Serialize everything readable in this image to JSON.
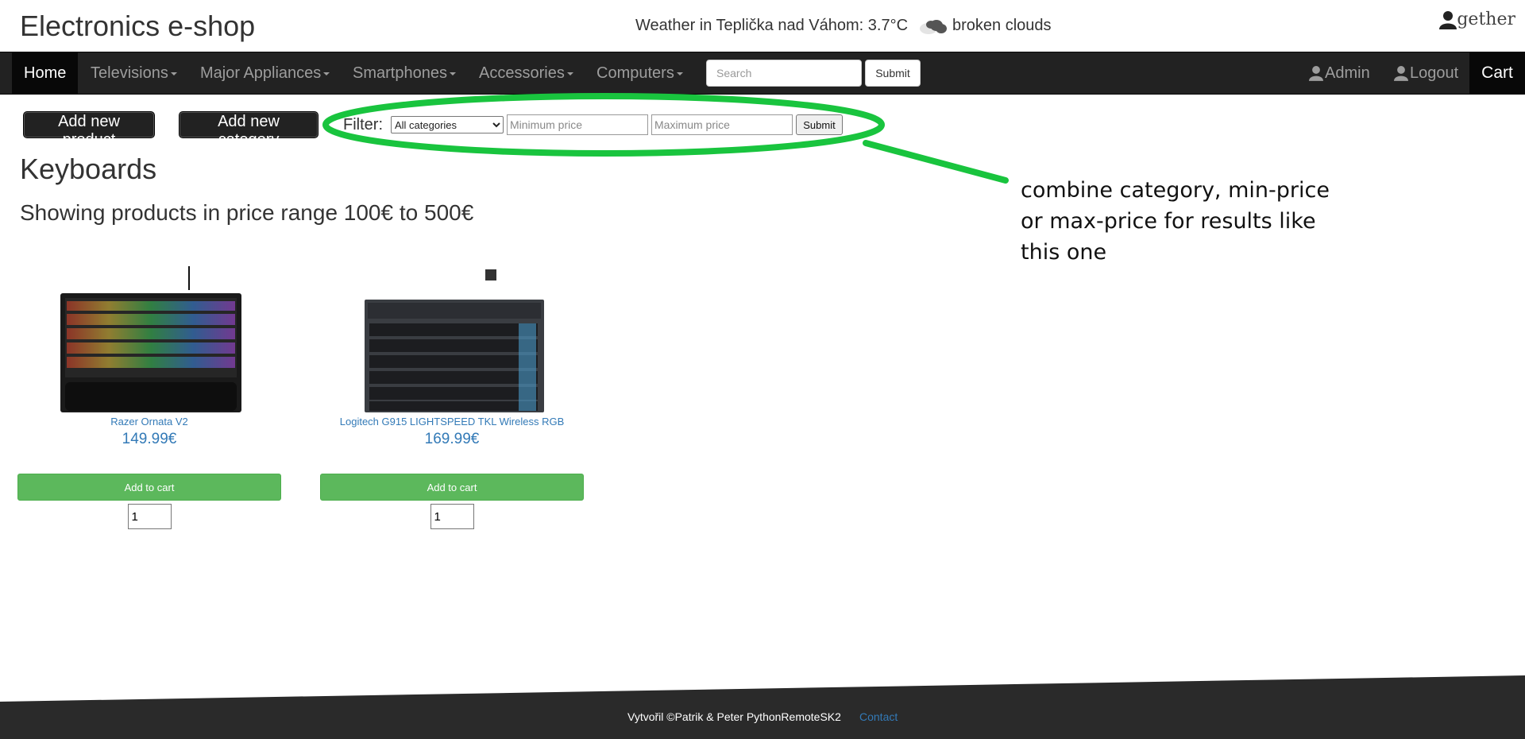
{
  "header": {
    "site_title": "Electronics e-shop",
    "weather_text": "Weather in Teplička nad Váhom: 3.7°C",
    "weather_icon": "cloud-icon",
    "weather_desc": "broken clouds",
    "username": "gether"
  },
  "nav": {
    "home": "Home",
    "items": [
      "Televisions",
      "Major Appliances",
      "Smartphones",
      "Accessories",
      "Computers"
    ],
    "search_placeholder": "Search",
    "search_submit": "Submit",
    "admin": "Admin",
    "logout": "Logout",
    "cart": "Cart"
  },
  "toolbar": {
    "add_product": "Add new product",
    "add_category": "Add new category",
    "filter_label": "Filter:",
    "category_selected": "All categories",
    "min_placeholder": "Minimum price",
    "max_placeholder": "Maximum price",
    "filter_submit": "Submit"
  },
  "annotation": {
    "text": "combine category, min-price or max-price for results like this one",
    "color": "#19c43e"
  },
  "main": {
    "category_title": "Keyboards",
    "range_title": "Showing products in price range 100€ to 500€"
  },
  "products": [
    {
      "name": "Razer Ornata V2",
      "price": "149.99€",
      "add_label": "Add to cart",
      "qty": "1"
    },
    {
      "name": "Logitech G915 LIGHTSPEED TKL Wireless RGB",
      "price": "169.99€",
      "add_label": "Add to cart",
      "qty": "1"
    }
  ],
  "footer": {
    "credit": "Vytvořil ©Patrik & Peter PythonRemoteSK2",
    "contact": "Contact"
  },
  "colors": {
    "navbar": "#222222",
    "add_to_cart": "#5cb85c",
    "link": "#337ab7"
  }
}
